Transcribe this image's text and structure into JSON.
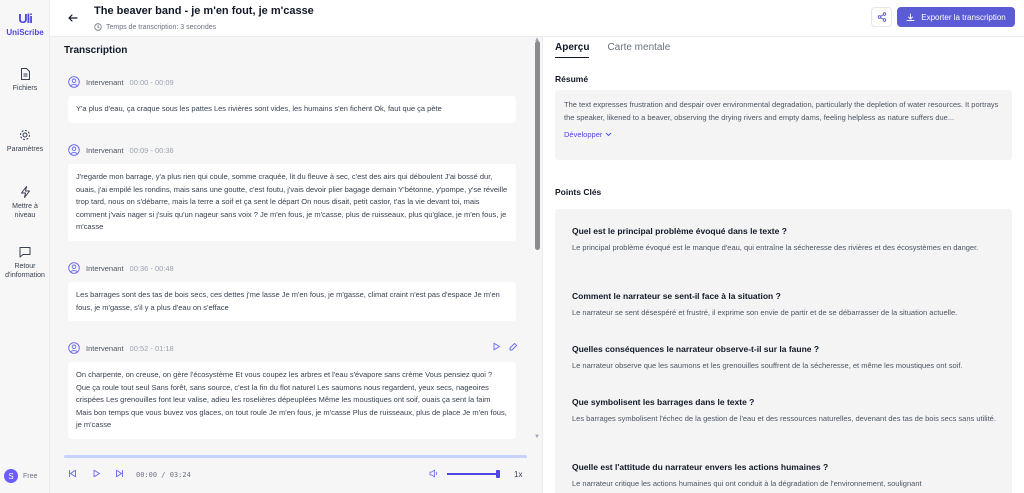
{
  "app": {
    "logo_mark": "Uli",
    "logo_text": "UniScribe"
  },
  "sidebar": {
    "items": [
      {
        "label": "Fichiers",
        "icon": "file-icon"
      },
      {
        "label": "Paramètres",
        "icon": "gear-icon"
      },
      {
        "label": "Mettre à niveau",
        "icon": "lightning-icon"
      },
      {
        "label": "Retour d'information",
        "icon": "chat-icon"
      }
    ],
    "user": {
      "initial": "S",
      "plan": "Free"
    }
  },
  "header": {
    "title": "The beaver band - je m'en fout, je m'casse",
    "subtitle": "Temps de transcription: 3 secondes",
    "export_label": "Exporter la transcription"
  },
  "transcript": {
    "title": "Transcription",
    "segments": [
      {
        "speaker": "Intervenant",
        "time": "00:00 - 00:09",
        "text": "Y'a plus d'eau, ça craque sous les pattes Les rivières sont vides, les humains s'en fichent Ok, faut que ça pète"
      },
      {
        "speaker": "Intervenant",
        "time": "00:09 - 00:36",
        "text": "J'regarde mon barrage, y'a plus rien qui coule, somme craquée, lit du fleuve à sec, c'est des airs qui déboulent J'ai bossé dur, ouais, j'ai empilé les rondins, mais sans une goutte, c'est foutu, j'vais devoir plier bagage demain Y'bétonne, y'pompe, y'se réveille trop tard, nous on s'débarre, mais la terre a soif et ça sent le départ On nous disait, petit castor, t'as la vie devant toi, mais comment j'vais nager si j'suis qu'un nageur sans voix ? Je m'en fous, je m'casse, plus de ruisseaux, plus qu'glace, je m'en fous, je m'casse"
      },
      {
        "speaker": "Intervenant",
        "time": "00:36 - 00:48",
        "text": "Les barrages sont des tas de bois secs, ces dettes j'me lasse Je m'en fous, je m'gasse, climat craint n'est pas d'espace Je m'en fous, je m'gasse, s'il y a plus d'eau on s'efface"
      },
      {
        "speaker": "Intervenant",
        "time": "00:52 - 01:18",
        "text": "On charpente, on creuse, on gère l'écosystème Et vous coupez les arbres et l'eau s'évapore sans crème Vous pensiez quoi ? Que ça roule tout seul Sans forêt, sans source, c'est la fin du flot naturel Les saumons nous regardent, yeux secs, nageoires crispées Les grenouilles font leur valise, adieu les roselières dépeuplées Même les moustiques ont soif, ouais ça sent la faim Mais bon temps que vous buvez vos glaces, on tout roule Je m'en fous, je m'casse Plus de ruisseaux, plus de place Je m'en fous, je m'casse"
      }
    ]
  },
  "player": {
    "time": "00:00 / 03:24",
    "speed": "1x",
    "volume": 1.0,
    "progress": 0.0
  },
  "right": {
    "tabs": [
      "Aperçu",
      "Carte mentale"
    ],
    "summary_heading": "Résumé",
    "summary_text": "The text expresses frustration and despair over environmental degradation, particularly the depletion of water resources. It portrays the speaker, likened to a beaver, observing the drying rivers and empty dams, feeling helpless as nature suffers due...",
    "expand_label": "Développer",
    "keypoints_heading": "Points Clés",
    "keypoints": [
      {
        "q": "Quel est le principal problème évoqué dans le texte ?",
        "a": "Le principal problème évoqué est le manque d'eau, qui entraîne la sécheresse des rivières et des écosystèmes en danger."
      },
      {
        "q": "Comment le narrateur se sent-il face à la situation ?",
        "a": "Le narrateur se sent désespéré et frustré, il exprime son envie de partir et de se débarrasser de la situation actuelle."
      },
      {
        "q": "Quelles conséquences le narrateur observe-t-il sur la faune ?",
        "a": "Le narrateur observe que les saumons et les grenouilles souffrent de la sécheresse, et même les moustiques ont soif."
      },
      {
        "q": "Que symbolisent les barrages dans le texte ?",
        "a": "Les barrages symbolisent l'échec de la gestion de l'eau et des ressources naturelles, devenant des tas de bois secs sans utilité."
      },
      {
        "q": "Quelle est l'attitude du narrateur envers les actions humaines ?",
        "a": "Le narrateur critique les actions humaines qui ont conduit à la dégradation de l'environnement, soulignant"
      }
    ]
  },
  "colors": {
    "accent": "#5b5bd6",
    "panel_bg": "#f6f6f7"
  }
}
